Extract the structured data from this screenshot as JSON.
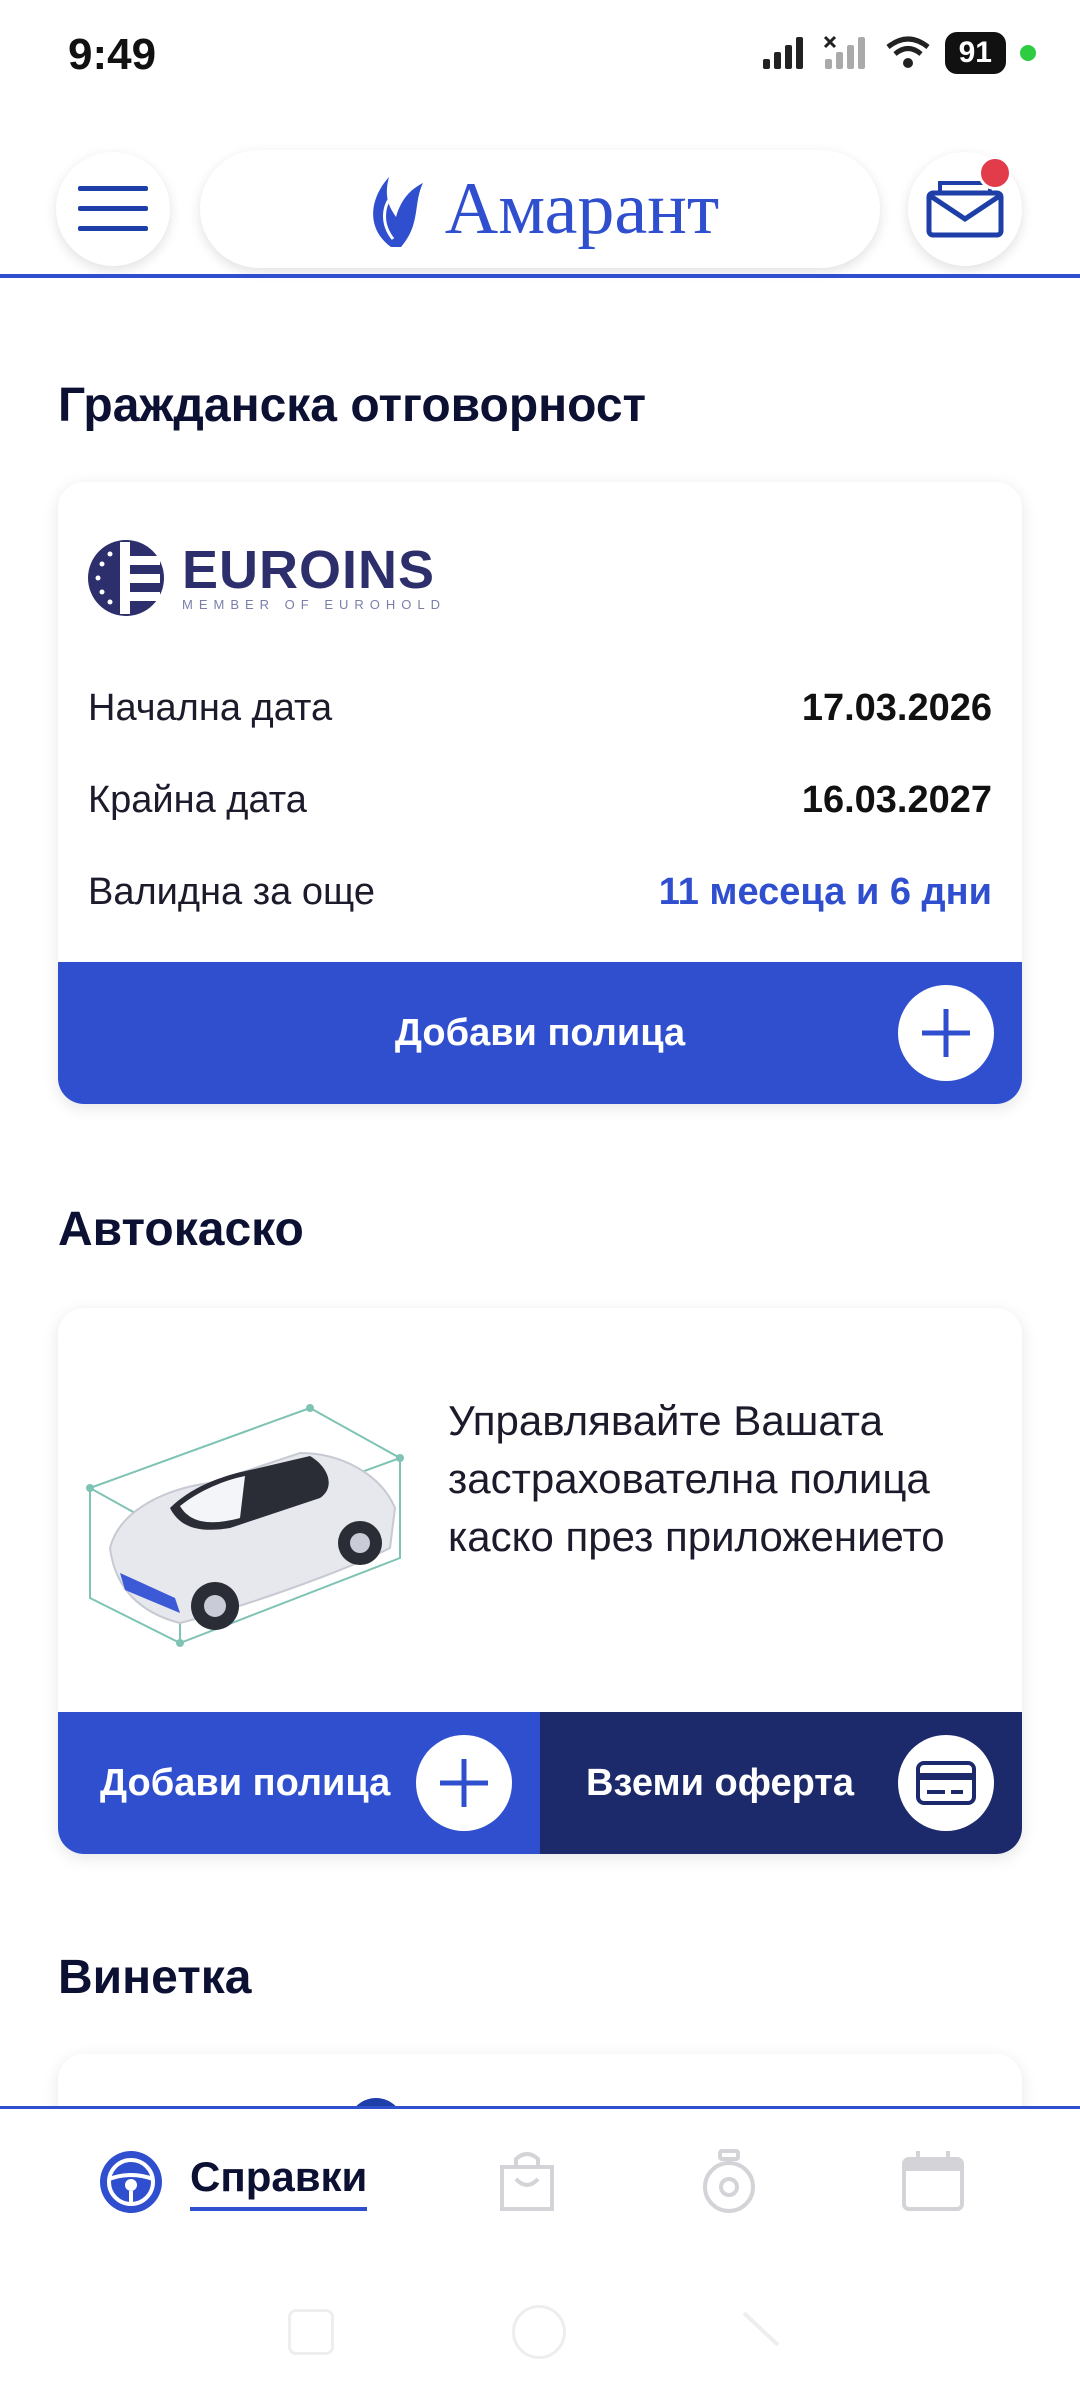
{
  "status_bar": {
    "time": "9:49",
    "battery": "91"
  },
  "header": {
    "logo_text": "Амарант"
  },
  "civil_liability": {
    "title": "Гражданска отговорност",
    "insurer_name": "EUROINS",
    "insurer_tagline": "MEMBER OF EUROHOLD",
    "rows": [
      {
        "label": "Начална дата",
        "value": "17.03.2026"
      },
      {
        "label": "Крайна дата",
        "value": "16.03.2027"
      },
      {
        "label": "Валидна за още",
        "value": "11 месеца и 6 дни"
      }
    ],
    "add_policy_label": "Добави полица"
  },
  "casco": {
    "title": "Автокаско",
    "description": "Управлявайте Вашата застрахователна полица каско през приложението",
    "add_policy_label": "Добави полица",
    "get_offer_label": "Вземи оферта"
  },
  "vignette": {
    "title": "Винетка"
  },
  "bottom_nav": {
    "items": [
      {
        "icon": "steering-wheel-icon",
        "label": "Справки"
      },
      {
        "icon": "shopping-bag-icon"
      },
      {
        "icon": "speedometer-icon"
      },
      {
        "icon": "calendar-icon"
      }
    ]
  },
  "colors": {
    "brand": "#2f4fcf",
    "dark_navy": "#1c2a6b",
    "badge": "#e23b4a"
  }
}
